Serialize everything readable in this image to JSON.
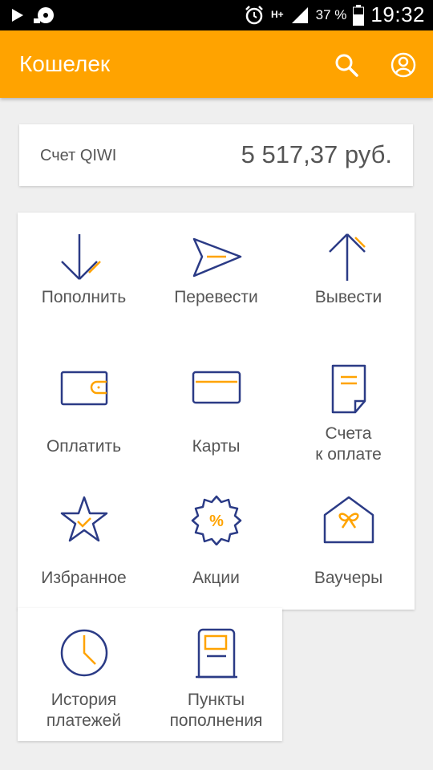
{
  "status_bar": {
    "battery_percent": "37 %",
    "network": "H+",
    "time": "19:32"
  },
  "app_bar": {
    "title": "Кошелек",
    "search_icon": "search-icon",
    "profile_icon": "account-circle-icon"
  },
  "balance": {
    "label": "Счет QIWI",
    "value": "5 517,37 руб."
  },
  "colors": {
    "accent": "#ffa300",
    "icon_blue": "#2b3b86",
    "icon_orange": "#ffa300"
  },
  "tiles": [
    {
      "label": "Пополнить",
      "icon": "top-up-icon"
    },
    {
      "label": "Перевести",
      "icon": "transfer-icon"
    },
    {
      "label": "Вывести",
      "icon": "withdraw-icon"
    },
    {
      "label": "Оплатить",
      "icon": "wallet-icon"
    },
    {
      "label": "Карты",
      "icon": "card-icon"
    },
    {
      "label": "Счета\nк оплате",
      "icon": "invoice-icon"
    },
    {
      "label": "Избранное",
      "icon": "star-icon"
    },
    {
      "label": "Акции",
      "icon": "promo-badge-icon"
    },
    {
      "label": "Ваучеры",
      "icon": "voucher-icon"
    },
    {
      "label": "История\nплатежей",
      "icon": "clock-icon"
    },
    {
      "label": "Пункты\nпополнения",
      "icon": "terminal-icon"
    }
  ]
}
